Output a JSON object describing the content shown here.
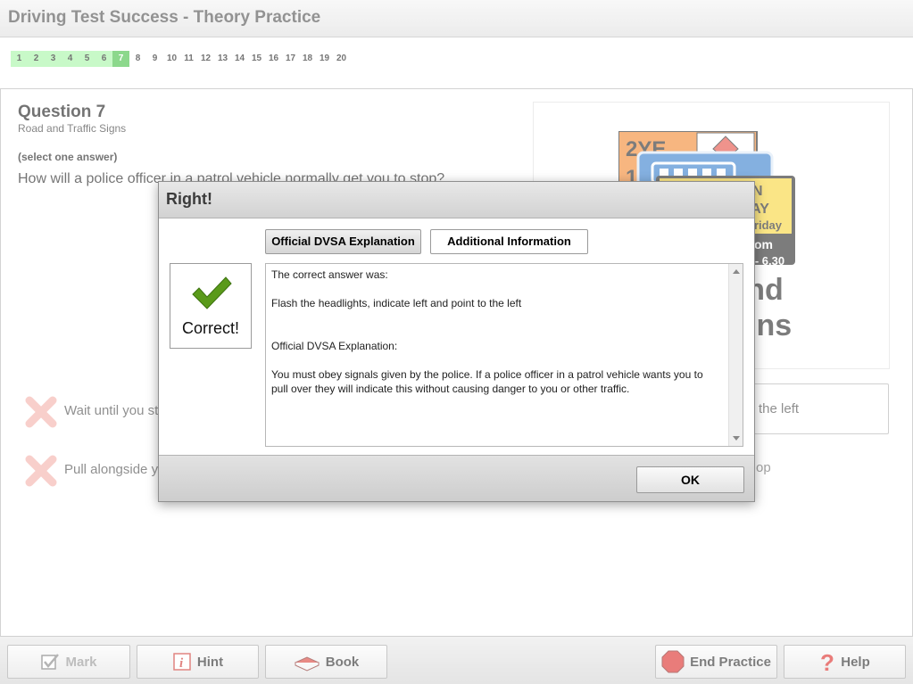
{
  "app": {
    "title": "Driving Test Success - Theory Practice"
  },
  "question_nav": {
    "numbers": [
      "1",
      "2",
      "3",
      "4",
      "5",
      "6",
      "7",
      "8",
      "9",
      "10",
      "11",
      "12",
      "13",
      "14",
      "15",
      "16",
      "17",
      "18",
      "19",
      "20"
    ],
    "completed": 6,
    "current": 7,
    "colors": {
      "done": "#9cf59c",
      "current": "#2fb92f"
    }
  },
  "question": {
    "title": "Question 7",
    "category": "Road and Traffic Signs",
    "instruction": "(select one answer)",
    "text": "How will a police officer in a patrol vehicle normally get you to stop?"
  },
  "image_panel": {
    "sign_texts": [
      "2YE",
      "1",
      "N",
      "WAY",
      "Friday",
      "om",
      "0 - 6.30"
    ],
    "caption_line1": "nd",
    "caption_line2": "gns"
  },
  "answers": {
    "a1": "Wait until you st",
    "a2": "Pull alongside yo",
    "a3": "t to the left",
    "a4": "op"
  },
  "dialog": {
    "title": "Right!",
    "tabs": [
      "Official DVSA Explanation",
      "Additional Information"
    ],
    "correct_label": "Correct!",
    "body": {
      "line1": "The correct answer was:",
      "line2": "Flash the headlights, indicate left and point to the left",
      "line3": "Official DVSA Explanation:",
      "line4": "You must obey signals given by the police. If a police officer in a patrol vehicle wants you to pull over they will indicate this without causing danger to you or other traffic."
    },
    "ok_label": "OK"
  },
  "toolbar": {
    "mark": "Mark",
    "hint": "Hint",
    "book": "Book",
    "end": "End Practice",
    "help": "Help"
  }
}
